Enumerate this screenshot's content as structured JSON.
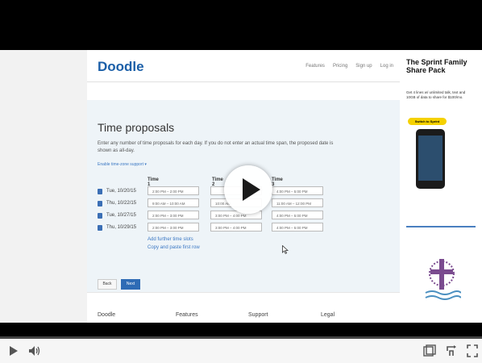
{
  "doodle": {
    "logo": "Doodle",
    "nav": {
      "features": "Features",
      "pricing": "Pricing",
      "signup": "Sign up",
      "login": "Log in"
    },
    "page_title": "Time proposals",
    "intro": "Enter any number of time proposals for each day. If you do not enter an actual time span, the proposed date is shown as all-day.",
    "timezone_link": "Enable time-zone support",
    "columns": [
      "Time 1",
      "Time 2",
      "Time 3"
    ],
    "rows": [
      {
        "date": "Tue, 10/20/15",
        "slots": [
          "2:00 PM – 2:00 PM",
          "",
          "4:00 PM – 5:00 PM"
        ]
      },
      {
        "date": "Thu, 10/22/15",
        "slots": [
          "9:00 AM – 10:00 AM",
          "10:00 AM",
          "11:00 AM – 12:00 PM"
        ]
      },
      {
        "date": "Tue, 10/27/15",
        "slots": [
          "2:00 PM – 3:00 PM",
          "3:00 PM – 4:00 PM",
          "4:00 PM – 5:00 PM"
        ]
      },
      {
        "date": "Thu, 10/29/15",
        "slots": [
          "2:00 PM – 3:00 PM",
          "3:00 PM – 4:00 PM",
          "4:00 PM – 5:00 PM"
        ]
      }
    ],
    "add_slots_link": "Add further time slots",
    "copy_row_link": "Copy and paste first row",
    "back_button": "Back",
    "next_button": "Next",
    "footer": [
      "Doodle",
      "Features",
      "Support",
      "Legal"
    ]
  },
  "ad": {
    "headline": "The Sprint Family Share Pack",
    "subtext": "Get 4 lines w/ unlimited talk, text and 10GB of data to share for $100/mo.",
    "cta": "Switch to Sprint"
  },
  "player": {
    "progress": 0.0
  },
  "icons": {
    "play_overlay": "play-circle-icon",
    "play": "play-icon",
    "volume": "volume-icon",
    "captions": "captions-icon",
    "watch_later": "watch-later-icon",
    "fullscreen": "fullscreen-icon"
  },
  "colors": {
    "doodle_blue": "#1b5fa8",
    "progress_red": "#cc181e",
    "cta_yellow": "#f5d100"
  }
}
